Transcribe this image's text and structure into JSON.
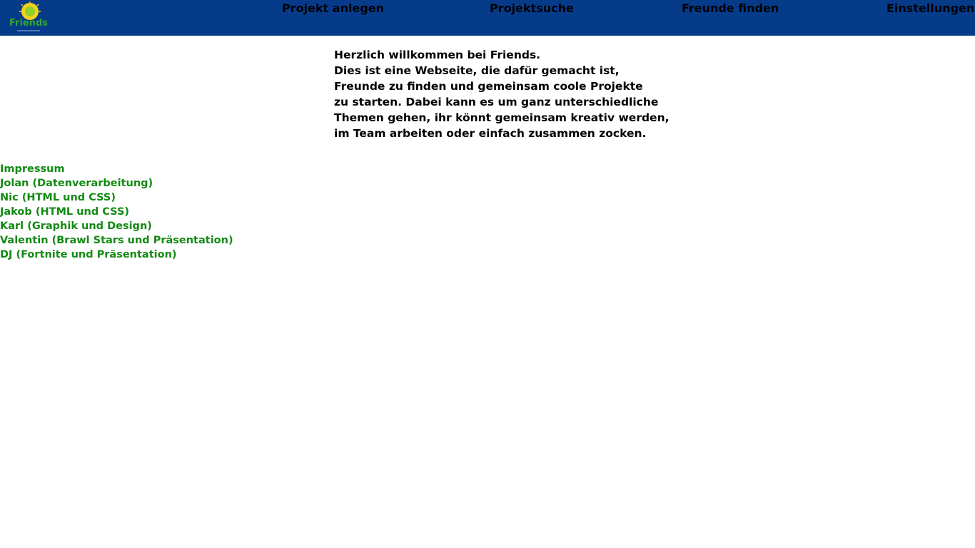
{
  "colors": {
    "header_bg": "#063b8a",
    "nav_text": "#000000",
    "link_green": "#138a13",
    "body_text": "#000000",
    "page_bg": "#ffffff"
  },
  "header": {
    "logo_icon": "friends-logo-icon",
    "logo_text": "Friends",
    "nav": [
      {
        "label": "Projekt anlegen"
      },
      {
        "label": "Projektsuche"
      },
      {
        "label": "Freunde finden"
      },
      {
        "label": "Einstellungen"
      }
    ]
  },
  "intro": {
    "lines": [
      "Herzlich willkommen bei Friends.",
      "Dies ist eine Webseite, die dafür gemacht ist,",
      "Freunde zu finden und gemeinsam coole Projekte",
      "zu starten. Dabei kann es um ganz unterschiedliche",
      "Themen gehen, ihr könnt gemeinsam kreativ werden,",
      "im Team arbeiten oder einfach zusammen zocken."
    ]
  },
  "footer": {
    "links": [
      "Impressum",
      "Jolan (Datenverarbeitung)",
      "Nic (HTML und CSS)",
      "Jakob (HTML und CSS)",
      "Karl (Graphik und Design)",
      "Valentin (Brawl Stars und Präsentation)",
      "DJ (Fortnite und Präsentation)"
    ]
  }
}
